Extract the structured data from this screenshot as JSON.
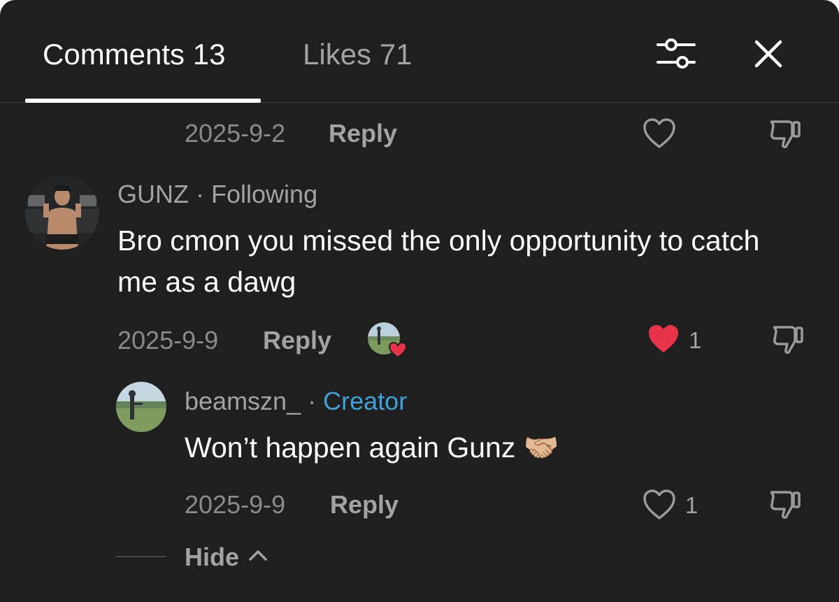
{
  "tabs": {
    "comments": "Comments 13",
    "likes": "Likes 71"
  },
  "icons": {
    "filter": "sliders-icon",
    "close": "close-icon",
    "like": "heart-icon",
    "dislike": "thumbs-down-icon"
  },
  "colors": {
    "background": "#1f1f1f",
    "liked_heart": "#e8334a",
    "creator": "#3fa1d6"
  },
  "top_comment": {
    "date": "2025-9-2",
    "reply_label": "Reply"
  },
  "comment": {
    "username": "GUNZ",
    "separator": "·",
    "relation": "Following",
    "text": "Bro cmon you missed the only opportunity to catch me as a dawg",
    "date": "2025-9-9",
    "reply_label": "Reply",
    "like_count": "1"
  },
  "reply": {
    "username": "beamszn_",
    "separator": "·",
    "role": "Creator",
    "text": "Won’t happen again Gunz 🤝🏼",
    "date": "2025-9-9",
    "reply_label": "Reply",
    "like_count": "1"
  },
  "hide": {
    "label": "Hide"
  }
}
